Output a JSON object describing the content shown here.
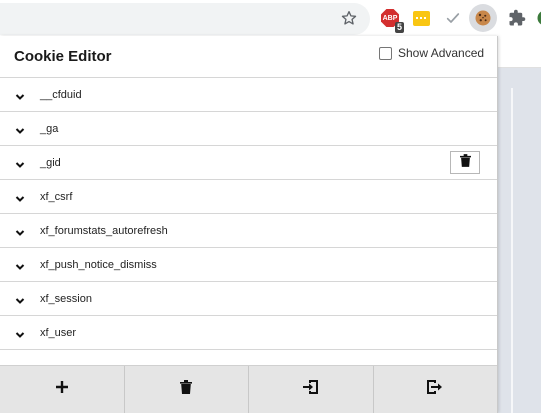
{
  "browser": {
    "toolbar_icons": [
      "star-icon",
      "adblock-icon",
      "yellow-extension-icon",
      "checkmark-icon",
      "cookie-icon",
      "puzzle-icon",
      "profile-icon"
    ],
    "adblock_logo": "ABP",
    "adblock_badge": "5"
  },
  "popup": {
    "title": "Cookie Editor",
    "show_advanced_label": "Show Advanced",
    "show_advanced_checked": false,
    "cookies": [
      {
        "name": "__cfduid"
      },
      {
        "name": "_ga"
      },
      {
        "name": "_gid",
        "hovered": true
      },
      {
        "name": "xf_csrf"
      },
      {
        "name": "xf_forumstats_autorefresh"
      },
      {
        "name": "xf_push_notice_dismiss"
      },
      {
        "name": "xf_session"
      },
      {
        "name": "xf_user"
      }
    ],
    "footer_buttons": [
      "add-icon",
      "trash-icon",
      "import-icon",
      "export-icon"
    ]
  },
  "colors": {
    "adblock_red": "#d32f2f",
    "extension_yellow": "#f9c613",
    "footer_bg": "#e5e5e5",
    "page_bg": "#dfe3ea"
  }
}
